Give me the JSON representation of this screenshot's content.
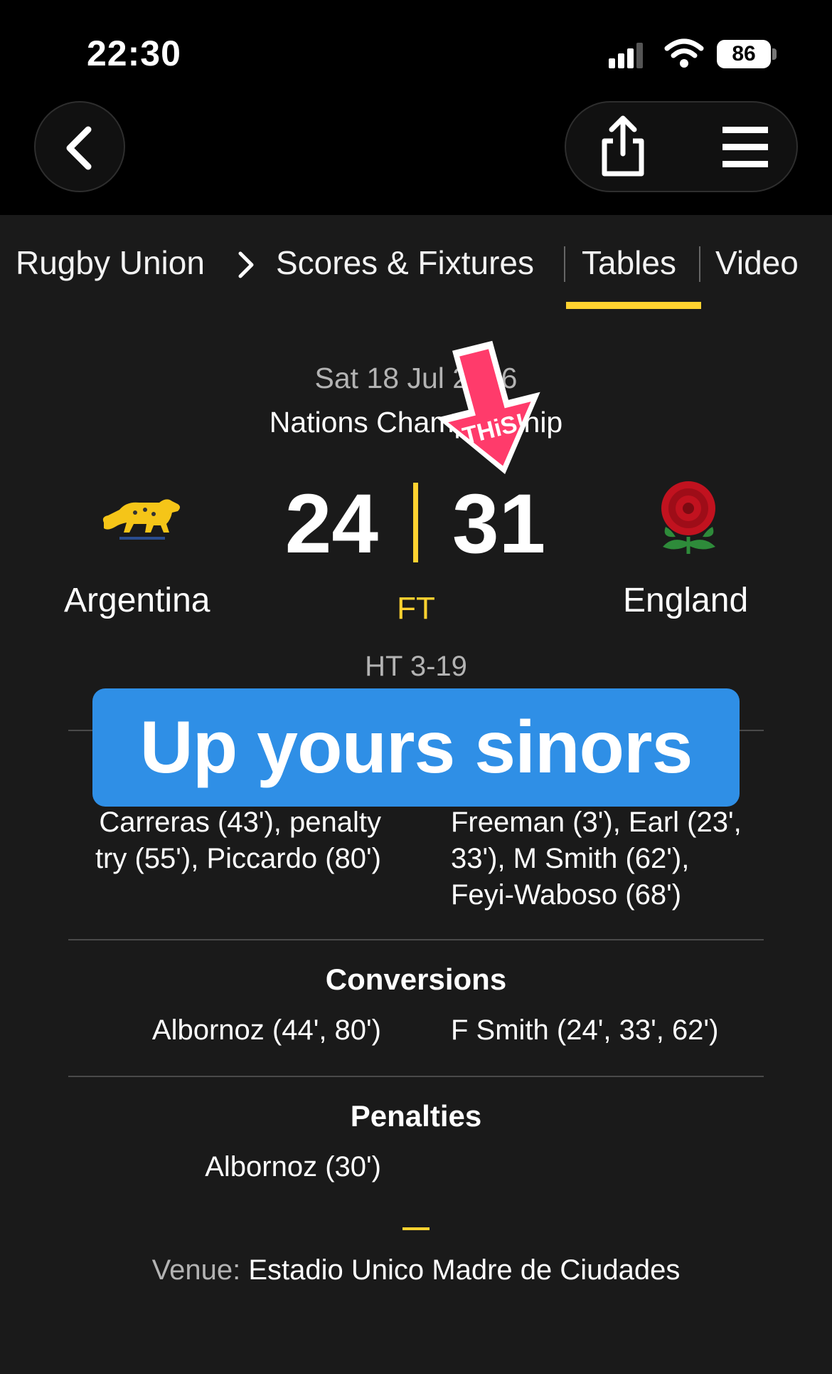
{
  "status_bar": {
    "time": "22:30",
    "battery": "86"
  },
  "nav": {
    "items": [
      "Rugby Union",
      "Scores & Fixtures",
      "Tables",
      "Video"
    ],
    "active": "Tables"
  },
  "match": {
    "date": "Sat 18 Jul 2026",
    "competition": "Nations Championship",
    "home_team": "Argentina",
    "away_team": "England",
    "home_score": "24",
    "away_score": "31",
    "status": "FT",
    "half_time": "HT 3-19"
  },
  "overlay": {
    "caption": "Up yours sinors",
    "sticker_text": "THiS!"
  },
  "tries": {
    "home": [
      "Carreras (43'), penalty",
      "try (55'), Piccardo (80')"
    ],
    "away": [
      "Freeman (3'), Earl (23',",
      "33'), M Smith (62'),",
      "Feyi-Waboso (68')"
    ]
  },
  "conversions": {
    "title": "Conversions",
    "home": "Albornoz (44', 80')",
    "away": "F Smith (24', 33', 62')"
  },
  "penalties": {
    "title": "Penalties",
    "home": "Albornoz (30')"
  },
  "venue": {
    "label": "Venue:",
    "name": "Estadio Unico Madre de Ciudades"
  },
  "colors": {
    "accent": "#ffd230",
    "caption_bg": "#2f8fe6",
    "background": "#1a1a1a"
  },
  "icons": [
    "back-chevron-icon",
    "share-icon",
    "menu-icon",
    "signal-icon",
    "wifi-icon",
    "battery-icon",
    "arrow-sticker-icon"
  ]
}
